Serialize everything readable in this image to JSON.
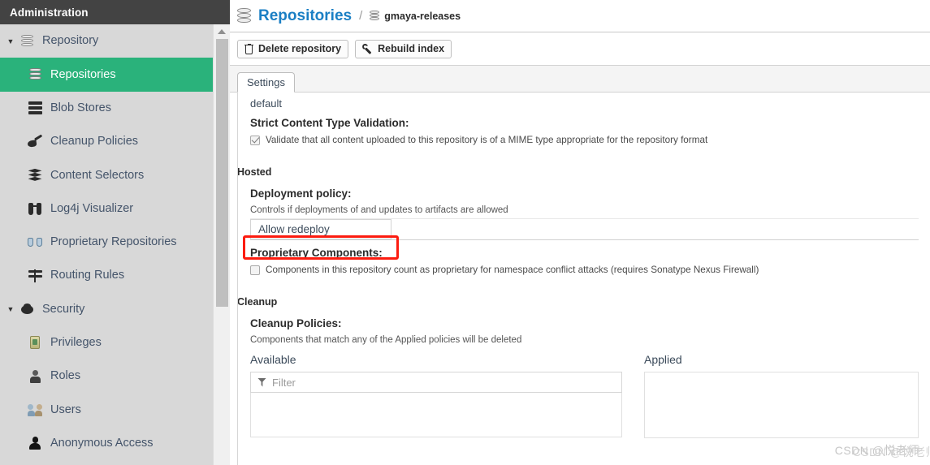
{
  "sidebar": {
    "header_title": "Administration",
    "items": [
      {
        "label": "Repository",
        "icon": "database-icon",
        "level": "group",
        "expanded": true,
        "active": false
      },
      {
        "label": "Repositories",
        "icon": "database-icon",
        "level": "child",
        "active": true
      },
      {
        "label": "Blob Stores",
        "icon": "blob-stores-icon",
        "level": "child",
        "active": false
      },
      {
        "label": "Cleanup Policies",
        "icon": "broom-icon",
        "level": "child",
        "active": false
      },
      {
        "label": "Content Selectors",
        "icon": "layers-icon",
        "level": "child",
        "active": false
      },
      {
        "label": "Log4j Visualizer",
        "icon": "binoculars-icon",
        "level": "child",
        "active": false
      },
      {
        "label": "Proprietary Repositories",
        "icon": "proprietary-icon",
        "level": "child",
        "active": false
      },
      {
        "label": "Routing Rules",
        "icon": "signpost-icon",
        "level": "child",
        "active": false
      },
      {
        "label": "Security",
        "icon": "security-icon",
        "level": "group",
        "expanded": true,
        "active": false
      },
      {
        "label": "Privileges",
        "icon": "privileges-icon",
        "level": "child",
        "active": false
      },
      {
        "label": "Roles",
        "icon": "roles-icon",
        "level": "child",
        "active": false
      },
      {
        "label": "Users",
        "icon": "users-icon",
        "level": "child",
        "active": false
      },
      {
        "label": "Anonymous Access",
        "icon": "anonymous-icon",
        "level": "child",
        "active": false
      }
    ]
  },
  "breadcrumb": {
    "root": "Repositories",
    "separator": "/",
    "current": "gmaya-releases"
  },
  "toolbar": {
    "delete_label": "Delete repository",
    "rebuild_label": "Rebuild index"
  },
  "tabs": [
    {
      "label": "Settings",
      "active": true
    }
  ],
  "form": {
    "top_value": "default",
    "strict_content_label": "Strict Content Type Validation:",
    "strict_content_checkbox_text": "Validate that all content uploaded to this repository is of a MIME type appropriate for the repository format",
    "strict_content_checked": true,
    "hosted_section": "Hosted",
    "deployment_policy_label": "Deployment policy:",
    "deployment_policy_help": "Controls if deployments of and updates to artifacts are allowed",
    "deployment_policy_value": "Allow redeploy",
    "proprietary_label": "Proprietary Components:",
    "proprietary_checkbox_text": "Components in this repository count as proprietary for namespace conflict attacks (requires Sonatype Nexus Firewall)",
    "proprietary_checked": false,
    "cleanup_section": "Cleanup",
    "cleanup_policies_label": "Cleanup Policies:",
    "cleanup_policies_help": "Components that match any of the Applied policies will be deleted",
    "available_header": "Available",
    "available_filter_placeholder": "Filter",
    "applied_header": "Applied"
  },
  "annotation": {
    "highlight_color": "#fc1c10",
    "highlight_target": "deployment-policy-select"
  },
  "watermark": {
    "text": "CSDN @悦老师"
  },
  "colors": {
    "sidebar_header_bg": "#434343",
    "sidebar_bg": "#d8d8d8",
    "active_item_bg": "#2ab27b",
    "link_blue": "#1b7fc4"
  }
}
